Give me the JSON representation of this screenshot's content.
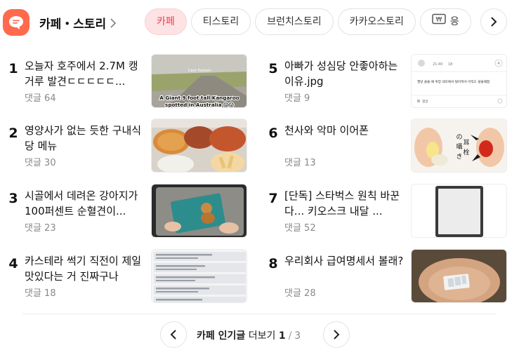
{
  "header": {
    "title": "카페・스토리",
    "tabs": [
      {
        "label": "카페",
        "active": true
      },
      {
        "label": "티스토리",
        "active": false
      },
      {
        "label": "브런치스토리",
        "active": false
      },
      {
        "label": "카카오스토리",
        "active": false
      },
      {
        "label": "응",
        "active": false,
        "icon": "wallet-icon"
      }
    ]
  },
  "items": [
    {
      "rank": "1",
      "title": "오늘자 호주에서 2.7M 캥거루 발견ㄷㄷㄷㄷㄷ...",
      "comments": "댓글 64",
      "thumb_caption_top": "Cant Tourism",
      "thumb_caption": "A Giant 9 foot tall Kangaroo spotted in Australia 😱😱"
    },
    {
      "rank": "2",
      "title": "영양사가 없는 듯한 구내식당 메뉴",
      "comments": "댓글 30"
    },
    {
      "rank": "3",
      "title": "시골에서 데려온 강아지가 100퍼센트 순혈견이...",
      "comments": "댓글 23"
    },
    {
      "rank": "4",
      "title": "카스테라 썩기 직전이 제일 맛있다는 거 진짜구나",
      "comments": "댓글 18"
    },
    {
      "rank": "5",
      "title": "아빠가 성심당 안좋아하는 이유.jpg",
      "comments": "댓글 9",
      "thumb_lines": [
        "21:40",
        "18",
        "4",
        "챗날 꼴을 때 위앙 네모에서 털어져서 아직도 끊을때함",
        "댓글"
      ]
    },
    {
      "rank": "6",
      "title": "천사와 악마 이어폰",
      "comments": "댓글 13",
      "thumb_text": "の囁き耳栓"
    },
    {
      "rank": "7",
      "title": "[단독] 스타벅스 원칙 바꾼다... 키오스크 내달 ...",
      "comments": "댓글 52"
    },
    {
      "rank": "8",
      "title": "우리회사 급여명세서 볼래?",
      "comments": "댓글 28"
    }
  ],
  "pager": {
    "label": "카페 인기글",
    "more": "더보기",
    "current": "1",
    "separator": "/",
    "total": "3"
  },
  "colors": {
    "brand": "#ff6a4d",
    "active_tab_bg": "#fde3e4",
    "active_tab_text": "#ef3b4f"
  }
}
